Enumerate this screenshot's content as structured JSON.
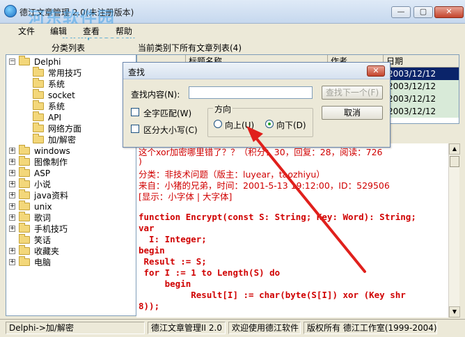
{
  "window": {
    "title": "德江文章管理 2.0(未注册版本)",
    "watermark": "河东软件园",
    "watermark_url": "www.pc0359.cn",
    "buttons": {
      "minimize": "—",
      "maximize": "▢",
      "close": "✕"
    }
  },
  "menu": [
    "文件",
    "编辑",
    "查看",
    "帮助"
  ],
  "left_panel": {
    "header": "分类列表",
    "tree": [
      {
        "label": "Delphi",
        "level": 0,
        "expander": "−"
      },
      {
        "label": "常用技巧",
        "level": 1,
        "expander": ""
      },
      {
        "label": "系统",
        "level": 1,
        "expander": ""
      },
      {
        "label": "socket",
        "level": 1,
        "expander": ""
      },
      {
        "label": "系统",
        "level": 1,
        "expander": ""
      },
      {
        "label": "API",
        "level": 1,
        "expander": ""
      },
      {
        "label": "网络方面",
        "level": 1,
        "expander": ""
      },
      {
        "label": "加/解密",
        "level": 1,
        "expander": ""
      },
      {
        "label": "windows",
        "level": 0,
        "expander": "+"
      },
      {
        "label": "图像制作",
        "level": 0,
        "expander": "+"
      },
      {
        "label": "ASP",
        "level": 0,
        "expander": "+"
      },
      {
        "label": "小说",
        "level": 0,
        "expander": "+"
      },
      {
        "label": "java资料",
        "level": 0,
        "expander": "+"
      },
      {
        "label": "unix",
        "level": 0,
        "expander": "+"
      },
      {
        "label": "歌词",
        "level": 0,
        "expander": "+"
      },
      {
        "label": "手机技巧",
        "level": 0,
        "expander": "+"
      },
      {
        "label": "笑话",
        "level": 0,
        "expander": ""
      },
      {
        "label": "收藏夹",
        "level": 0,
        "expander": "+"
      },
      {
        "label": "电脑",
        "level": 0,
        "expander": "+"
      }
    ]
  },
  "article_list": {
    "header": "当前类别下所有文章列表(4)",
    "columns": [
      "标题名称",
      "作者",
      "日期"
    ],
    "dates": [
      "2003/12/12",
      "2003/12/12",
      "2003/12/12",
      "2003/12/12"
    ],
    "selected_row": 0
  },
  "article": {
    "lines": [
      "这个xor加密哪里错了？？（积分：30，回复：28，阅读：726",
      ")",
      "分类：非技术问题（版主：luyear，taozhiyu）",
      "来自：小猪的兄弟，时间：2001-5-13 19:12:00，ID：529506",
      "[显示：小字体 | 大字体]",
      "",
      "function Encrypt(const S: String; Key: Word): String;",
      "var",
      "  I: Integer;",
      "begin",
      " Result := S;",
      " for I := 1 to Length(S) do",
      "     begin",
      "          Result[I] := char(byte(S[I]) xor (Key shr",
      "8));"
    ]
  },
  "statusbar": [
    "Delphi->加/解密",
    "德江文章管理II 2.0",
    "欢迎使用德江软件",
    "版权所有 德江工作室(1999-2004)"
  ],
  "find_dialog": {
    "title": "查找",
    "content_label": "查找内容(N):",
    "content_value": "",
    "find_next_label": "查找下一个(F)",
    "cancel_label": "取消",
    "match_whole_label": "全字匹配(W)",
    "match_case_label": "区分大小写(C)",
    "direction_label": "方向",
    "up_label": "向上(U)",
    "down_label": "向下(D)",
    "direction_selected": "down"
  },
  "colors": {
    "article_text": "#d00000",
    "selection": "#0a246a",
    "row_alt": "#d8ead8",
    "annotation_arrow": "#e0201c"
  }
}
